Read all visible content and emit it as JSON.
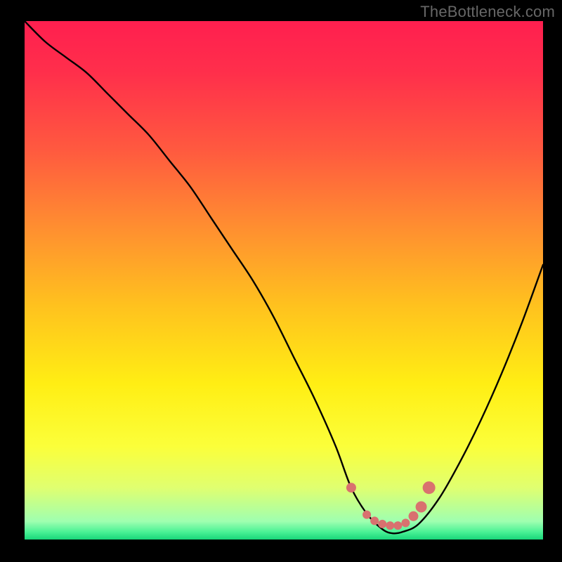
{
  "watermark": "TheBottleneck.com",
  "chart_data": {
    "type": "line",
    "title": "",
    "xlabel": "",
    "ylabel": "",
    "xlim": [
      0,
      100
    ],
    "ylim": [
      0,
      100
    ],
    "gradient_stops": [
      {
        "offset": 0.0,
        "color": "#ff1f4f"
      },
      {
        "offset": 0.1,
        "color": "#ff2f4b"
      },
      {
        "offset": 0.25,
        "color": "#ff5a3f"
      },
      {
        "offset": 0.4,
        "color": "#ff8f30"
      },
      {
        "offset": 0.55,
        "color": "#ffc21e"
      },
      {
        "offset": 0.7,
        "color": "#ffee14"
      },
      {
        "offset": 0.82,
        "color": "#fbff3a"
      },
      {
        "offset": 0.9,
        "color": "#e0ff70"
      },
      {
        "offset": 0.965,
        "color": "#9fffb0"
      },
      {
        "offset": 0.985,
        "color": "#4cf296"
      },
      {
        "offset": 1.0,
        "color": "#18d67a"
      }
    ],
    "series": [
      {
        "name": "bottleneck-curve",
        "x": [
          0,
          4,
          8,
          12,
          16,
          20,
          24,
          28,
          32,
          36,
          40,
          44,
          48,
          52,
          56,
          60,
          63,
          66,
          69,
          71,
          73,
          76,
          80,
          84,
          88,
          92,
          96,
          100
        ],
        "y": [
          100,
          96,
          93,
          90,
          86,
          82,
          78,
          73,
          68,
          62,
          56,
          50,
          43,
          35,
          27,
          18,
          10,
          5,
          2,
          1.2,
          1.5,
          3,
          8,
          15,
          23,
          32,
          42,
          53
        ]
      }
    ],
    "highlight_points": {
      "name": "optimal-range",
      "color": "#d9716f",
      "radius_small": 5,
      "radius_large": 9,
      "points": [
        {
          "x": 63,
          "y": 10,
          "r": 7
        },
        {
          "x": 66,
          "y": 4.8,
          "r": 6
        },
        {
          "x": 67.5,
          "y": 3.6,
          "r": 6
        },
        {
          "x": 69,
          "y": 3.0,
          "r": 6
        },
        {
          "x": 70.5,
          "y": 2.7,
          "r": 6
        },
        {
          "x": 72,
          "y": 2.7,
          "r": 6
        },
        {
          "x": 73.5,
          "y": 3.2,
          "r": 6
        },
        {
          "x": 75,
          "y": 4.5,
          "r": 7
        },
        {
          "x": 76.5,
          "y": 6.3,
          "r": 8
        },
        {
          "x": 78,
          "y": 10.0,
          "r": 9
        }
      ]
    }
  }
}
